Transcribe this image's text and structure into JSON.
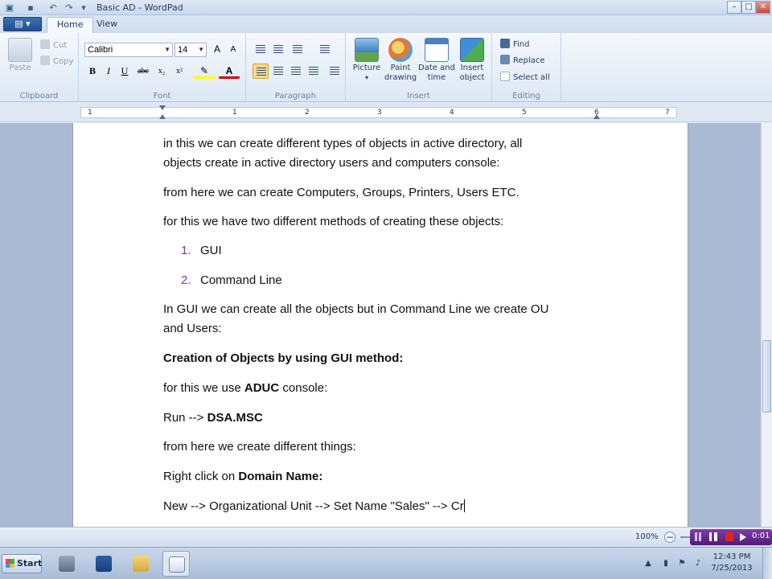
{
  "window": {
    "title": "Basic AD - WordPad",
    "minimize_glyph": "–",
    "maximize_glyph": "□",
    "close_glyph": "✕"
  },
  "quick_access": [
    "save-icon",
    "undo-icon",
    "redo-icon",
    "customize-icon"
  ],
  "tabs": [
    {
      "label": "Home",
      "active": true
    },
    {
      "label": "View",
      "active": false
    }
  ],
  "app_menu_glyph": "▤ ▾",
  "ribbon": {
    "clipboard": {
      "label": "Clipboard",
      "paste": "Paste",
      "cut": "Cut",
      "copy": "Copy"
    },
    "font": {
      "label": "Font",
      "family": "Calibri",
      "size": "14",
      "grow": "A",
      "shrink": "A",
      "bold": "B",
      "italic": "I",
      "underline": "U",
      "strike": "abc",
      "subscript": "x₂",
      "superscript": "x²",
      "highlight_glyph": "✎",
      "color_glyph": "A"
    },
    "paragraph": {
      "label": "Paragraph"
    },
    "insert": {
      "label": "Insert",
      "picture": "Picture",
      "paint_line1": "Paint",
      "paint_line2": "drawing",
      "date_line1": "Date and",
      "date_line2": "time",
      "object_line1": "Insert",
      "object_line2": "object"
    },
    "editing": {
      "label": "Editing",
      "find": "Find",
      "replace": "Replace",
      "select_all": "Select all"
    }
  },
  "ruler": {
    "numbers": [
      "1",
      "1",
      "2",
      "3",
      "4",
      "5",
      "6",
      "7"
    ]
  },
  "document": {
    "p1_line1": "in this we can create different types of objects in active directory, all",
    "p1_line2": "objects create in active directory users and computers console:",
    "p2": "from here we can create Computers, Groups, Printers, Users ETC.",
    "p3": "for this we have two different methods of creating these objects:",
    "list": [
      {
        "num": "1.",
        "text": "GUI"
      },
      {
        "num": "2.",
        "text": "Command Line"
      }
    ],
    "p4_line1": "In GUI we can create all the objects but in Command Line we create OU",
    "p4_line2": "and Users:",
    "heading": "Creation of Objects by using GUI method:",
    "p5_pre": "for this we use ",
    "p5_bold": "ADUC",
    "p5_post": " console:",
    "p6_pre": "Run --> ",
    "p6_bold": "DSA.MSC",
    "p7": "from here we create different things:",
    "p8_pre": "Right click on ",
    "p8_bold": "Domain Name:",
    "p9": "New --> Organizational Unit --> Set Name \"Sales\" --> Cr"
  },
  "status": {
    "zoom": "100%",
    "zoom_out": "−",
    "zoom_in": "+",
    "recorder_time": "0:01"
  },
  "taskbar": {
    "start": "Start",
    "apps": [
      "server-manager-icon",
      "powershell-icon",
      "explorer-icon",
      "wordpad-icon"
    ],
    "time": "12:43 PM",
    "date": "7/25/2013"
  }
}
